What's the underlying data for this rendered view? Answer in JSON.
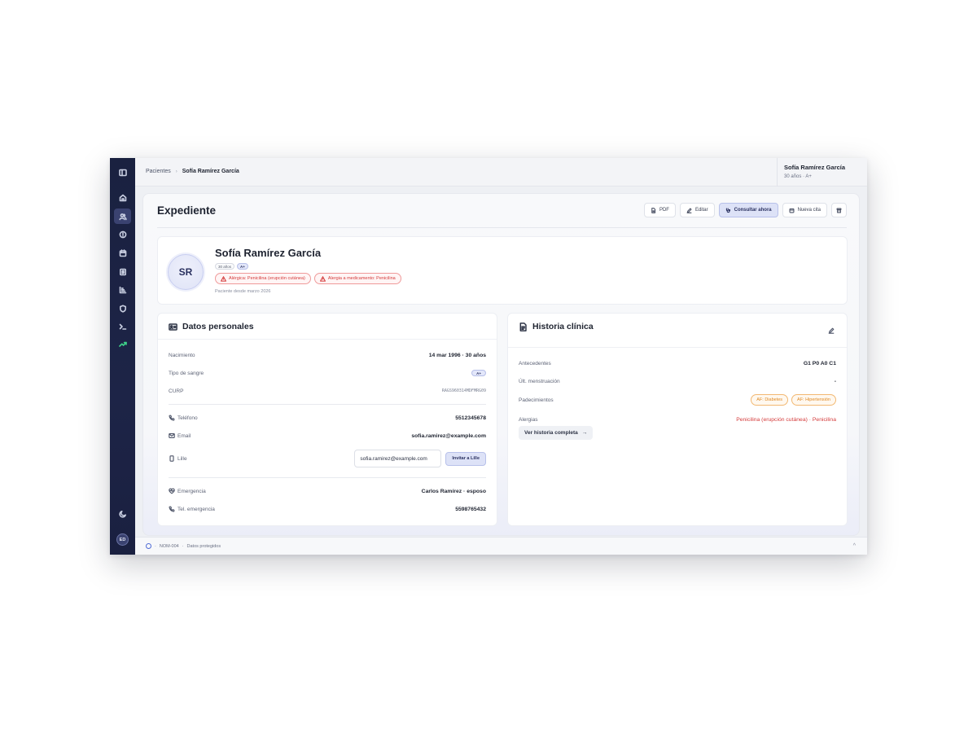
{
  "breadcrumb": {
    "parent": "Pacientes",
    "current": "Sofía Ramírez García"
  },
  "top_patient": {
    "name": "Sofía Ramírez García",
    "sub": "30 años · A+"
  },
  "page_title": "Expediente",
  "actions": {
    "pdf": "PDF",
    "edit": "Editar",
    "consult": "Consultar ahora",
    "new_appt": "Nueva cita"
  },
  "patient": {
    "initials": "SR",
    "name": "Sofía Ramírez García",
    "age_chip": "30 años",
    "blood_chip": "A+",
    "allergies": [
      "Alérgica: Penicilina (erupción cutánea)",
      "Alergia a medicamento: Penicilina"
    ],
    "since": "Paciente desde marzo 2026"
  },
  "personal": {
    "title": "Datos personales",
    "rows": [
      {
        "label": "Nacimiento",
        "value": "14 mar 1996 · 30 años"
      },
      {
        "label": "Tipo de sangre",
        "value": "A+"
      },
      {
        "label": "CURP",
        "value": "RAGS960314MDFMRG09"
      }
    ],
    "contact": [
      {
        "label": "Teléfono",
        "value": "5512345678"
      },
      {
        "label": "Email",
        "value": "sofia.ramirez@example.com"
      }
    ],
    "lille": {
      "label": "Lille",
      "input_value": "sofia.ramirez@example.com",
      "button": "Invitar a Lille"
    },
    "emergency": [
      {
        "label": "Emergencia",
        "value": "Carlos Ramírez · esposo"
      },
      {
        "label": "Tel. emergencia",
        "value": "5598765432"
      }
    ]
  },
  "history": {
    "title": "Historia clínica",
    "rows": [
      {
        "label": "Antecedentes",
        "value": "G1 P0 A0 C1"
      },
      {
        "label": "Últ. menstruación",
        "value": "-"
      },
      {
        "label": "Padecimientos",
        "badges": [
          "AF: Diabetes",
          "AF: Hipertensión"
        ]
      },
      {
        "label": "Alergias",
        "value": "Penicilina (erupción cutánea) · Penicilina"
      }
    ],
    "see_full": "Ver historia completa",
    "see_full_arrow": "→"
  },
  "footer": {
    "code": "NOM-004",
    "protected": "Datos protegidos",
    "sep": "·",
    "chevron": "^"
  },
  "sidebar": {
    "icons": [
      "sidebar-toggle-icon",
      "home-icon",
      "users-icon",
      "alert-icon",
      "calendar-icon",
      "billing-icon",
      "chart-icon",
      "shield-icon",
      "terminal-icon",
      "trend-icon",
      "moon-icon"
    ],
    "avatar": "ED"
  },
  "colors": {
    "sidebar": "#1a2140",
    "accent": "#dde2f7",
    "danger": "#d43b3b",
    "warning": "#e08a25",
    "trend": "#3ed28a"
  }
}
